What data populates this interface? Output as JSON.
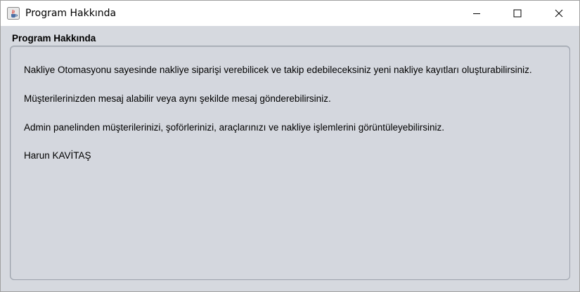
{
  "window": {
    "title": "Program Hakkında",
    "controls": {
      "minimize_icon": "minimize-icon",
      "maximize_icon": "maximize-icon",
      "close_icon": "close-icon"
    }
  },
  "content": {
    "section_title": "Program Hakkında",
    "paragraphs": [
      "Nakliye Otomasyonu sayesinde nakliye siparişi verebilicek ve takip edebileceksiniz yeni nakliye kayıtları oluşturabilirsiniz.",
      "Müşterilerinizden mesaj alabilir veya aynı şekilde mesaj gönderebilirsiniz.",
      "Admin panelinden müşterilerinizi, şoförlerinizi, araçlarınızı ve nakliye işlemlerini görüntüleyebilirsiniz.",
      "Harun KAVİTAŞ"
    ]
  },
  "colors": {
    "background": "#d6d9df",
    "titlebar": "#ffffff",
    "panel_border": "#9ba1ab"
  }
}
